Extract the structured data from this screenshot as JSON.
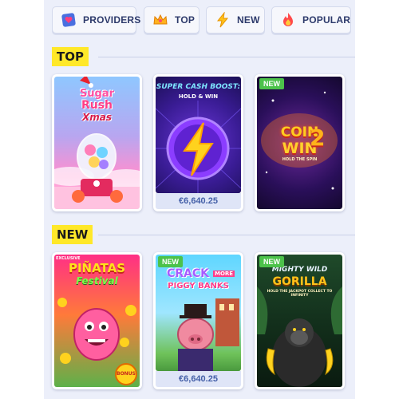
{
  "tabs": [
    {
      "label": "PROVIDERS",
      "icon": "providers-heart-icon"
    },
    {
      "label": "TOP",
      "icon": "crown-icon"
    },
    {
      "label": "NEW",
      "icon": "lightning-icon"
    },
    {
      "label": "POPULAR",
      "icon": "flame-icon"
    }
  ],
  "sections": [
    {
      "title": "TOP"
    },
    {
      "title": "NEW"
    }
  ],
  "games": {
    "top": [
      {
        "name_line1": "Sugar",
        "name_line2": "Rush",
        "name_line3": "Xmas",
        "new": false,
        "jackpot": ""
      },
      {
        "name_line1": "SUPER CASH BOOST:",
        "name_line2": "HOLD & WIN",
        "new": false,
        "jackpot": "€6,640.25"
      },
      {
        "name_line1": "COIN",
        "name_line2": "WIN",
        "name_line3": "2",
        "tagline": "HOLD THE SPIN",
        "new": true,
        "new_label": "NEW",
        "jackpot": ""
      }
    ],
    "new": [
      {
        "name_line1": "PIÑATAS",
        "name_line2": "Festival",
        "tag": "EXCLUSIVE",
        "sub": "BONUS",
        "new": false,
        "jackpot": ""
      },
      {
        "name_line1": "CRACK",
        "name_line2": "MORE",
        "name_line3": "PIGGY BANKS",
        "new": true,
        "new_label": "NEW",
        "jackpot": "€6,640.25"
      },
      {
        "name_line1": "MIGHTY WILD",
        "name_line2": "GORILLA",
        "tagline": "HOLD THE JACKPOT COLLECT TO INFINITY",
        "new": true,
        "new_label": "NEW",
        "jackpot": ""
      }
    ]
  },
  "colors": {
    "panel_bg": "#eceffa",
    "section_highlight": "#ffe829",
    "new_badge": "#4cc24a",
    "jackpot_text": "#4560a8"
  }
}
